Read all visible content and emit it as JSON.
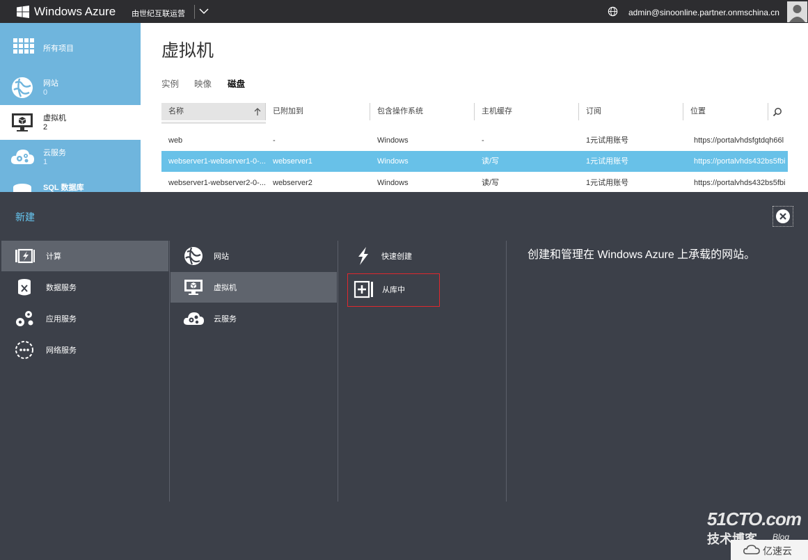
{
  "topbar": {
    "brand": "Windows Azure",
    "subscription": "由世纪互联运营",
    "user": "admin@sinoonline.partner.onmschina.cn"
  },
  "sidebar": {
    "items": [
      {
        "label": "所有项目",
        "count": "",
        "icon": "grid-icon"
      },
      {
        "label": "网站",
        "count": "0",
        "icon": "website-globe-icon"
      },
      {
        "label": "虚拟机",
        "count": "2",
        "icon": "virtual-machine-icon"
      },
      {
        "label": "云服务",
        "count": "1",
        "icon": "cloud-service-icon"
      },
      {
        "label": "SQL 数据库",
        "count": "",
        "icon": "database-icon"
      }
    ]
  },
  "main": {
    "title": "虚拟机",
    "tabs": [
      "实例",
      "映像",
      "磁盘"
    ],
    "active_tab": "磁盘",
    "columns": [
      "名称",
      "已附加到",
      "包含操作系统",
      "主机缓存",
      "订阅",
      "位置"
    ],
    "rows": [
      [
        "web",
        "-",
        "Windows",
        "-",
        "1元试用账号",
        "https://portalvhdsfgtdqh66l"
      ],
      [
        "webserver1-webserver1-0-...",
        "webserver1",
        "Windows",
        "读/写",
        "1元试用账号",
        "https://portalvhds432bs5fbi"
      ],
      [
        "webserver1-webserver2-0-...",
        "webserver2",
        "Windows",
        "读/写",
        "1元试用账号",
        "https://portalvhds432bs5fbi"
      ]
    ],
    "selected_row": 1
  },
  "drawer": {
    "title": "新建",
    "col1": [
      {
        "label": "计算",
        "icon": "compute-icon"
      },
      {
        "label": "数据服务",
        "icon": "data-services-icon"
      },
      {
        "label": "应用服务",
        "icon": "app-services-icon"
      },
      {
        "label": "网络服务",
        "icon": "network-services-icon"
      }
    ],
    "col2": [
      {
        "label": "网站",
        "icon": "website-globe-icon"
      },
      {
        "label": "虚拟机",
        "icon": "virtual-machine-icon"
      },
      {
        "label": "云服务",
        "icon": "cloud-service-icon"
      }
    ],
    "col3": [
      {
        "label": "快速创建",
        "icon": "lightning-icon"
      },
      {
        "label": "从库中",
        "icon": "plus-box-icon"
      }
    ],
    "description": "创建和管理在 Windows Azure 上承载的网站。"
  },
  "watermark": {
    "brand": "51CTO.com",
    "sub": "技术博客",
    "blog": "Blog",
    "cloud": "亿速云"
  },
  "colors": {
    "topbar": "#2d2d30",
    "sidebar": "#6fb5dd",
    "selected_row": "#68c1e8",
    "drawer": "#3c4049",
    "accent": "#67c8f3",
    "highlight_box": "#e0282e"
  }
}
